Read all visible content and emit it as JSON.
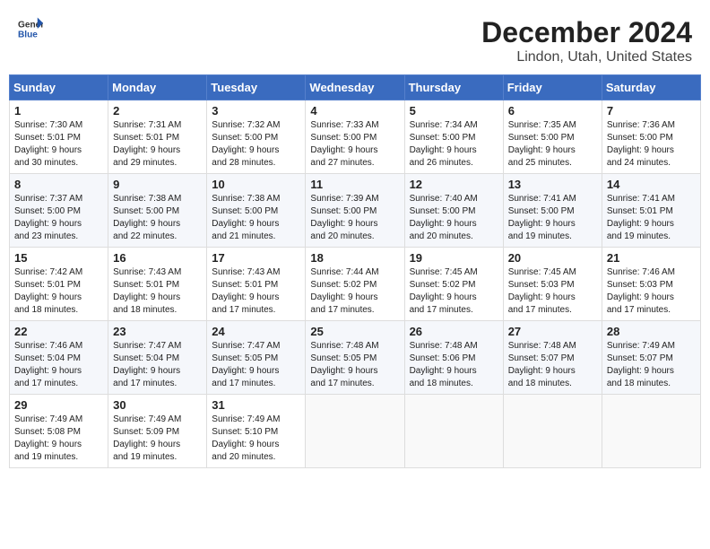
{
  "logo": {
    "general": "General",
    "blue": "Blue"
  },
  "header": {
    "month": "December 2024",
    "location": "Lindon, Utah, United States"
  },
  "days_of_week": [
    "Sunday",
    "Monday",
    "Tuesday",
    "Wednesday",
    "Thursday",
    "Friday",
    "Saturday"
  ],
  "weeks": [
    [
      {
        "day": "1",
        "info": "Sunrise: 7:30 AM\nSunset: 5:01 PM\nDaylight: 9 hours\nand 30 minutes."
      },
      {
        "day": "2",
        "info": "Sunrise: 7:31 AM\nSunset: 5:01 PM\nDaylight: 9 hours\nand 29 minutes."
      },
      {
        "day": "3",
        "info": "Sunrise: 7:32 AM\nSunset: 5:00 PM\nDaylight: 9 hours\nand 28 minutes."
      },
      {
        "day": "4",
        "info": "Sunrise: 7:33 AM\nSunset: 5:00 PM\nDaylight: 9 hours\nand 27 minutes."
      },
      {
        "day": "5",
        "info": "Sunrise: 7:34 AM\nSunset: 5:00 PM\nDaylight: 9 hours\nand 26 minutes."
      },
      {
        "day": "6",
        "info": "Sunrise: 7:35 AM\nSunset: 5:00 PM\nDaylight: 9 hours\nand 25 minutes."
      },
      {
        "day": "7",
        "info": "Sunrise: 7:36 AM\nSunset: 5:00 PM\nDaylight: 9 hours\nand 24 minutes."
      }
    ],
    [
      {
        "day": "8",
        "info": "Sunrise: 7:37 AM\nSunset: 5:00 PM\nDaylight: 9 hours\nand 23 minutes."
      },
      {
        "day": "9",
        "info": "Sunrise: 7:38 AM\nSunset: 5:00 PM\nDaylight: 9 hours\nand 22 minutes."
      },
      {
        "day": "10",
        "info": "Sunrise: 7:38 AM\nSunset: 5:00 PM\nDaylight: 9 hours\nand 21 minutes."
      },
      {
        "day": "11",
        "info": "Sunrise: 7:39 AM\nSunset: 5:00 PM\nDaylight: 9 hours\nand 20 minutes."
      },
      {
        "day": "12",
        "info": "Sunrise: 7:40 AM\nSunset: 5:00 PM\nDaylight: 9 hours\nand 20 minutes."
      },
      {
        "day": "13",
        "info": "Sunrise: 7:41 AM\nSunset: 5:00 PM\nDaylight: 9 hours\nand 19 minutes."
      },
      {
        "day": "14",
        "info": "Sunrise: 7:41 AM\nSunset: 5:01 PM\nDaylight: 9 hours\nand 19 minutes."
      }
    ],
    [
      {
        "day": "15",
        "info": "Sunrise: 7:42 AM\nSunset: 5:01 PM\nDaylight: 9 hours\nand 18 minutes."
      },
      {
        "day": "16",
        "info": "Sunrise: 7:43 AM\nSunset: 5:01 PM\nDaylight: 9 hours\nand 18 minutes."
      },
      {
        "day": "17",
        "info": "Sunrise: 7:43 AM\nSunset: 5:01 PM\nDaylight: 9 hours\nand 17 minutes."
      },
      {
        "day": "18",
        "info": "Sunrise: 7:44 AM\nSunset: 5:02 PM\nDaylight: 9 hours\nand 17 minutes."
      },
      {
        "day": "19",
        "info": "Sunrise: 7:45 AM\nSunset: 5:02 PM\nDaylight: 9 hours\nand 17 minutes."
      },
      {
        "day": "20",
        "info": "Sunrise: 7:45 AM\nSunset: 5:03 PM\nDaylight: 9 hours\nand 17 minutes."
      },
      {
        "day": "21",
        "info": "Sunrise: 7:46 AM\nSunset: 5:03 PM\nDaylight: 9 hours\nand 17 minutes."
      }
    ],
    [
      {
        "day": "22",
        "info": "Sunrise: 7:46 AM\nSunset: 5:04 PM\nDaylight: 9 hours\nand 17 minutes."
      },
      {
        "day": "23",
        "info": "Sunrise: 7:47 AM\nSunset: 5:04 PM\nDaylight: 9 hours\nand 17 minutes."
      },
      {
        "day": "24",
        "info": "Sunrise: 7:47 AM\nSunset: 5:05 PM\nDaylight: 9 hours\nand 17 minutes."
      },
      {
        "day": "25",
        "info": "Sunrise: 7:48 AM\nSunset: 5:05 PM\nDaylight: 9 hours\nand 17 minutes."
      },
      {
        "day": "26",
        "info": "Sunrise: 7:48 AM\nSunset: 5:06 PM\nDaylight: 9 hours\nand 18 minutes."
      },
      {
        "day": "27",
        "info": "Sunrise: 7:48 AM\nSunset: 5:07 PM\nDaylight: 9 hours\nand 18 minutes."
      },
      {
        "day": "28",
        "info": "Sunrise: 7:49 AM\nSunset: 5:07 PM\nDaylight: 9 hours\nand 18 minutes."
      }
    ],
    [
      {
        "day": "29",
        "info": "Sunrise: 7:49 AM\nSunset: 5:08 PM\nDaylight: 9 hours\nand 19 minutes."
      },
      {
        "day": "30",
        "info": "Sunrise: 7:49 AM\nSunset: 5:09 PM\nDaylight: 9 hours\nand 19 minutes."
      },
      {
        "day": "31",
        "info": "Sunrise: 7:49 AM\nSunset: 5:10 PM\nDaylight: 9 hours\nand 20 minutes."
      },
      {
        "day": "",
        "info": ""
      },
      {
        "day": "",
        "info": ""
      },
      {
        "day": "",
        "info": ""
      },
      {
        "day": "",
        "info": ""
      }
    ]
  ]
}
